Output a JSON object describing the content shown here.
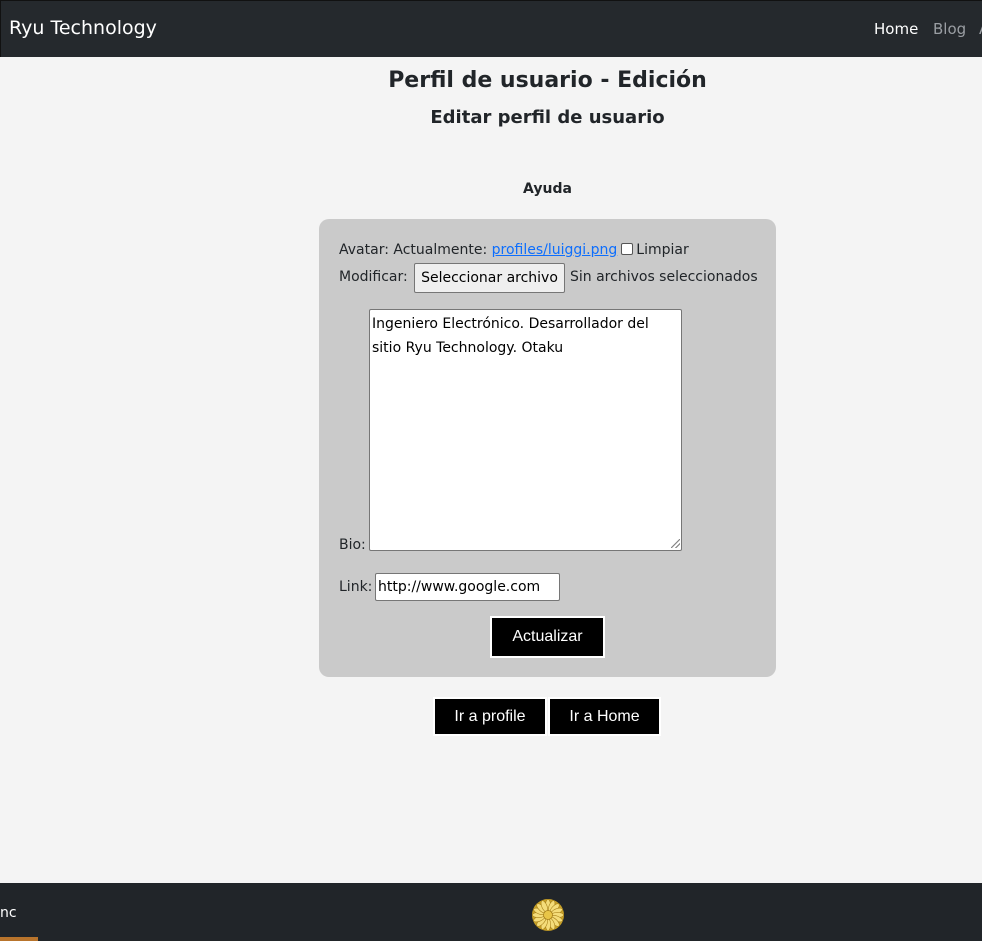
{
  "navbar": {
    "brand": "Ryu Technology",
    "links": [
      {
        "label": "Home"
      },
      {
        "label": "Blog"
      },
      {
        "label": "A"
      }
    ]
  },
  "page": {
    "title": "Perfil de usuario - Edición",
    "subtitle": "Editar perfil de usuario",
    "help_label": "Ayuda"
  },
  "form": {
    "avatar_label": "Avatar: Actualmente:",
    "avatar_file": "profiles/luiggi.png",
    "clear_label": "Limpiar",
    "modify_label": "Modificar:",
    "file_button_label": "Seleccionar archivo",
    "no_file_text": "Sin archivos seleccionados",
    "bio_label": "Bio:",
    "bio_value": "Ingeniero Electrónico. Desarrollador del sitio Ryu Technology. Otaku",
    "link_label": "Link:",
    "link_value": "http://www.google.com",
    "submit_label": "Actualizar"
  },
  "actions": {
    "profile_label": "Ir a profile",
    "home_label": "Ir a Home"
  },
  "footer": {
    "cut_text": "nc",
    "logo_icon": "chrysanthemum-seal-icon"
  },
  "colors": {
    "navbar_bg": "#25292d",
    "page_bg": "#f4f4f4",
    "panel_bg": "#cacaca",
    "link": "#0d6efd",
    "button_bg": "#000000",
    "footer_bg": "#212529",
    "footer_accent": "#b8742c"
  }
}
